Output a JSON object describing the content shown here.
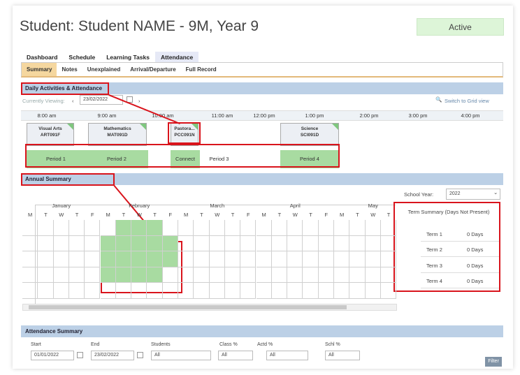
{
  "header": {
    "title": "Student: Student NAME - 9M, Year 9",
    "status": "Active"
  },
  "tabs": [
    "Dashboard",
    "Schedule",
    "Learning Tasks",
    "Attendance"
  ],
  "subtabs": [
    "Summary",
    "Notes",
    "Unexplained",
    "Arrival/Departure",
    "Full Record"
  ],
  "daily": {
    "heading": "Daily Activities & Attendance",
    "viewing_label": "Currently Viewing:",
    "prev": "‹",
    "next": "›",
    "date": "23/02/2022",
    "switch": "Switch to Grid view",
    "times": [
      "8:00 am",
      "9:00 am",
      "10:00 am",
      "11:00 am",
      "12:00 pm",
      "1:00 pm",
      "2:00 pm",
      "3:00 pm",
      "4:00 pm"
    ],
    "lessons": [
      {
        "name": "Visual Arts",
        "code": "ART091F"
      },
      {
        "name": "Mathematics",
        "code": "MAT091D"
      },
      {
        "name": "Pastora...",
        "code": "PCC091N"
      },
      {
        "name": "Science",
        "code": "SCI091D"
      }
    ],
    "periods": [
      "Period 1",
      "Period 2",
      "",
      "Connect",
      "Period 3",
      "",
      "Period 4"
    ]
  },
  "annual": {
    "heading": "Annual Summary",
    "school_year_label": "School Year:",
    "school_year": "2022",
    "months": [
      "January",
      "February",
      "March",
      "April",
      "May"
    ],
    "days": [
      "M",
      "T",
      "W",
      "T",
      "F"
    ],
    "terms_title": "Term Summary (Days Not Present)",
    "terms": [
      {
        "term": "Term 1",
        "days": "0 Days"
      },
      {
        "term": "Term 2",
        "days": "0 Days"
      },
      {
        "term": "Term 3",
        "days": "0 Days"
      },
      {
        "term": "Term 4",
        "days": "0 Days"
      }
    ]
  },
  "attendance_summary": {
    "heading": "Attendance Summary",
    "labels": {
      "start": "Start",
      "end": "End",
      "students": "Students",
      "class": "Class %",
      "actd": "Actd %",
      "schl": "Schl %"
    },
    "start": "01/01/2022",
    "end": "23/02/2022",
    "students": "All",
    "class": "All",
    "actd": "All",
    "schl": "All",
    "filter": "Filter"
  },
  "colors": {
    "accent_red": "#d9141c",
    "present_green": "#a8dba1",
    "header_blue": "#bcd0e6",
    "active_bg": "#ddf5d8"
  }
}
